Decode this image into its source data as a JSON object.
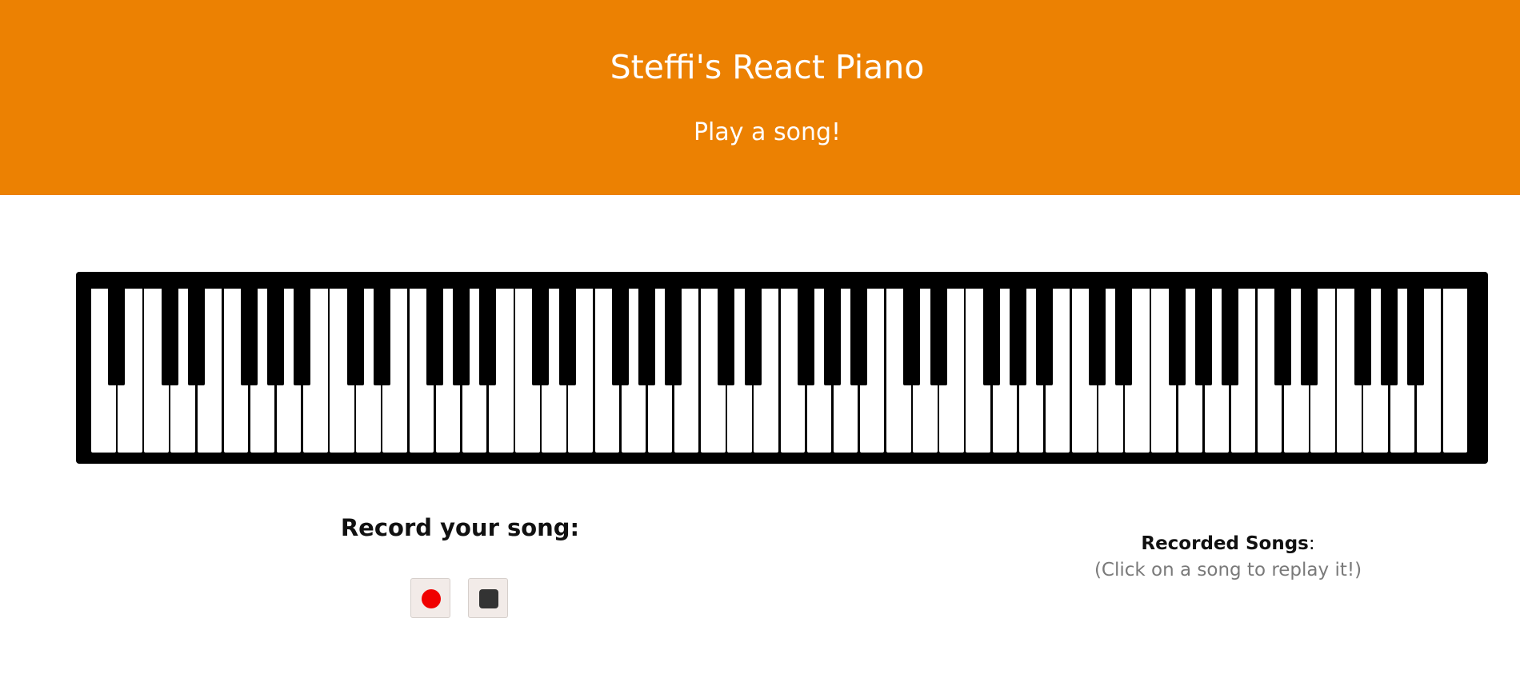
{
  "header": {
    "title": "Steffi's React Piano",
    "subtitle": "Play a song!"
  },
  "piano": {
    "white_key_count": 52,
    "black_key_pattern": [
      "A#0",
      "C#",
      "D#",
      "F#",
      "G#",
      "A#"
    ]
  },
  "recorder": {
    "heading": "Record your song:",
    "record_button": {
      "icon": "record-icon"
    },
    "stop_button": {
      "icon": "stop-icon"
    }
  },
  "recorded_songs": {
    "heading": "Recorded Songs",
    "heading_suffix": ":",
    "hint": "(Click on a song to replay it!)"
  },
  "colors": {
    "header_bg": "#ec8102",
    "header_text": "#ffffff",
    "record_dot": "#f00000",
    "stop_square": "#333333",
    "piano_frame": "#000000"
  }
}
